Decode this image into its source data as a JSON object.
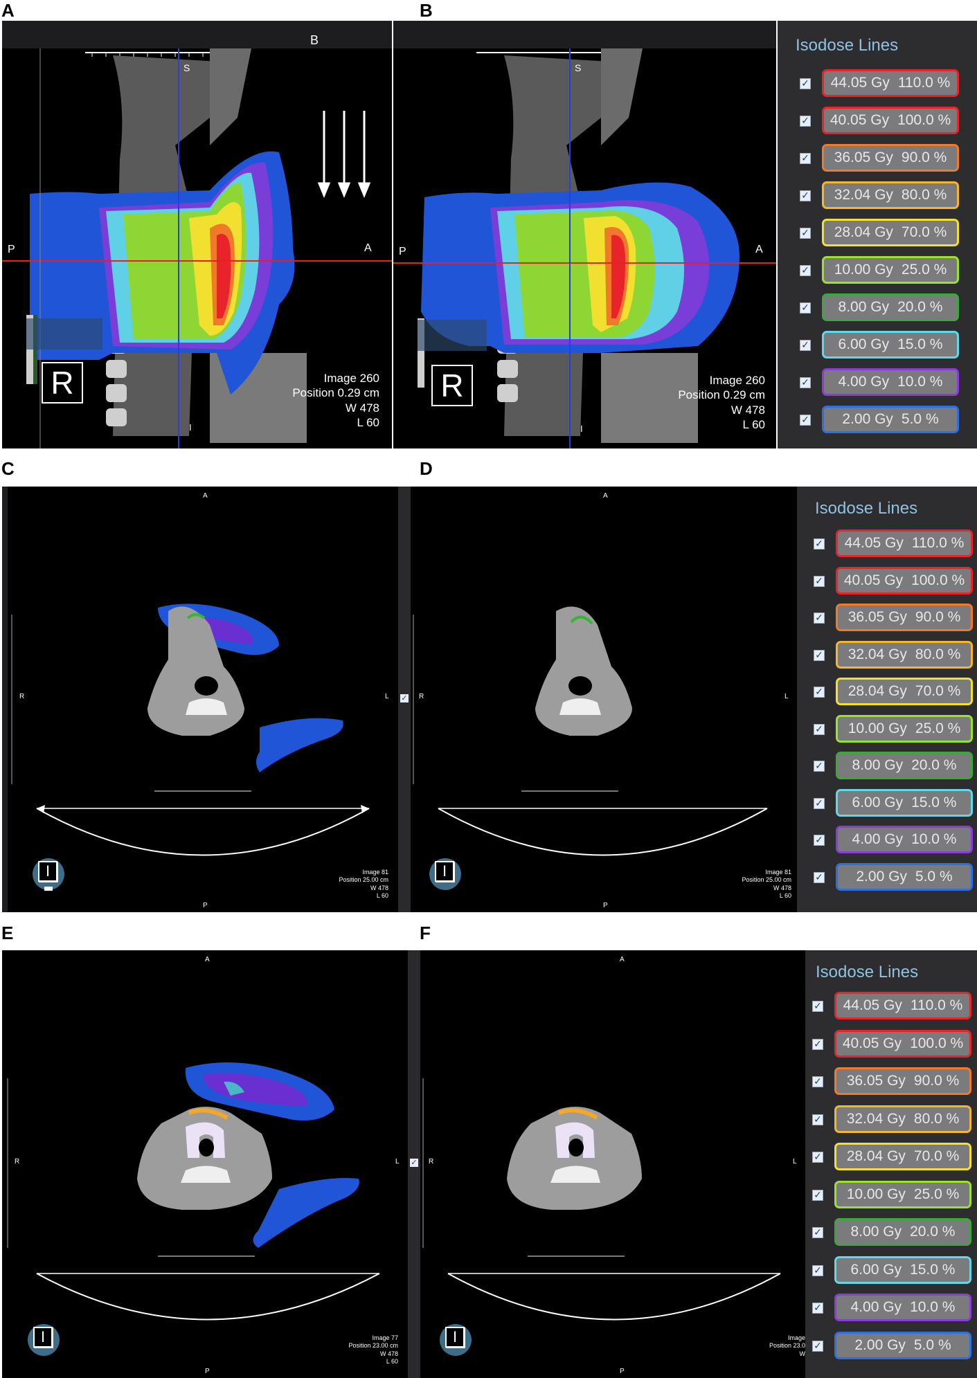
{
  "panels": {
    "A": {
      "letter": "A",
      "orient_top": "B",
      "orient_s": "S",
      "orient_p": "P",
      "orient_a": "A",
      "orient_i": "I",
      "orient_box": "R",
      "image": "Image  260",
      "position": "Position  0.29 cm",
      "w": "W  478",
      "l": "L    60"
    },
    "B": {
      "letter": "B",
      "orient_s": "S",
      "orient_p": "P",
      "orient_a": "A",
      "orient_i": "I",
      "orient_box": "R",
      "image": "Image  260",
      "position": "Position  0.29 cm",
      "w": "W  478",
      "l": "L    60"
    },
    "C": {
      "letter": "C",
      "orient_a": "A",
      "orient_r": "R",
      "orient_l": "L",
      "orient_p": "P",
      "orient_box": "I",
      "image": "Image  81",
      "position": "Position  25.00 cm",
      "w": "W  478",
      "l": "L    60"
    },
    "D": {
      "letter": "D",
      "orient_a": "A",
      "orient_r": "R",
      "orient_l": "L",
      "orient_p": "P",
      "orient_box": "I",
      "image": "Image  81",
      "position": "Position  25.00 cm",
      "w": "W  478",
      "l": "L    60"
    },
    "E": {
      "letter": "E",
      "orient_a": "A",
      "orient_r": "R",
      "orient_l": "L",
      "orient_p": "P",
      "orient_box": "I",
      "image": "Image  77",
      "position": "Position  23.00 cm",
      "w": "W  478",
      "l": "L    60"
    },
    "F": {
      "letter": "F",
      "orient_a": "A",
      "orient_r": "R",
      "orient_l": "L",
      "orient_p": "P",
      "orient_box": "I",
      "image": "Image",
      "position": "Position  23.0",
      "w": "W"
    }
  },
  "legend": {
    "title": "Isodose Lines",
    "check_glyph": "✓",
    "lines": [
      {
        "gy": "44.05 Gy",
        "pct": "110.0 %",
        "color": "#e8232a"
      },
      {
        "gy": "40.05 Gy",
        "pct": "100.0 %",
        "color": "#e8232a"
      },
      {
        "gy": "36.05 Gy",
        "pct": "90.0 %",
        "color": "#f07a2a"
      },
      {
        "gy": "32.04 Gy",
        "pct": "80.0 %",
        "color": "#f5b52c"
      },
      {
        "gy": "28.04 Gy",
        "pct": "70.0 %",
        "color": "#f2e12f"
      },
      {
        "gy": "10.00 Gy",
        "pct": "25.0 %",
        "color": "#9be22f"
      },
      {
        "gy": "8.00 Gy",
        "pct": "20.0 %",
        "color": "#3aa83a"
      },
      {
        "gy": "6.00 Gy",
        "pct": "15.0 %",
        "color": "#5fd8ea"
      },
      {
        "gy": "4.00 Gy",
        "pct": "10.0 %",
        "color": "#8a3bdc"
      },
      {
        "gy": "2.00 Gy",
        "pct": "5.0 %",
        "color": "#2d6fe0"
      }
    ]
  }
}
